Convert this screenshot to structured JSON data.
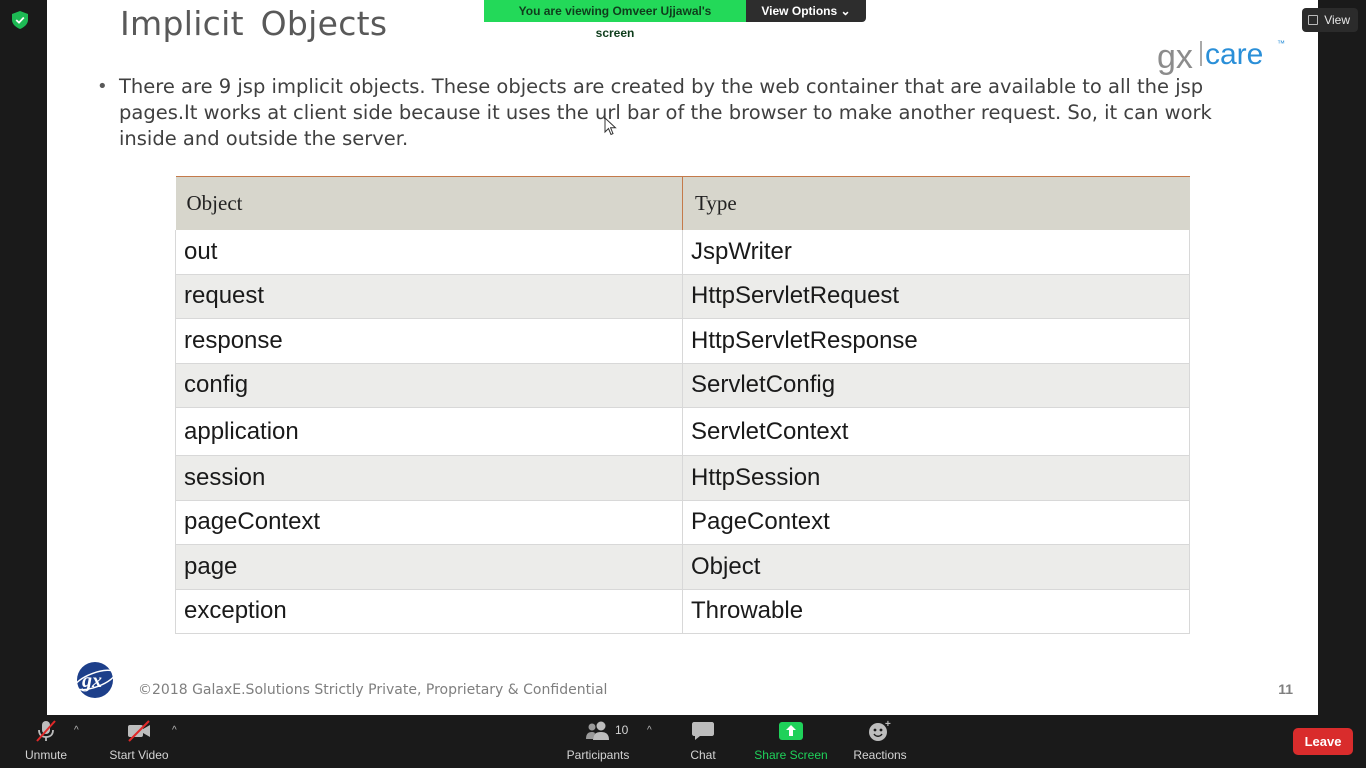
{
  "banner": {
    "message": "You are viewing Omveer Ujjawal's screen",
    "view_options": "View Options",
    "view_options_icon": "chevron-down-icon"
  },
  "view_button": {
    "label": "View",
    "icon": "grid-view-icon"
  },
  "slide": {
    "title": "Implicit  Objects",
    "logo_text": "gx|care™",
    "bullet": "There are 9 jsp implicit objects. These objects are created by the web container that are available to all the jsp pages.It works at client side because it uses the url bar of the browser to make another request. So, it can work inside and outside the server.",
    "table": {
      "headers": [
        "Object",
        "Type"
      ],
      "rows": [
        [
          "out",
          "JspWriter"
        ],
        [
          "request",
          "HttpServletRequest"
        ],
        [
          "response",
          "HttpServletResponse"
        ],
        [
          "config",
          "ServletConfig"
        ],
        [
          "application",
          "ServletContext"
        ],
        [
          "session",
          "HttpSession"
        ],
        [
          "pageContext",
          "PageContext"
        ],
        [
          "page",
          "Object"
        ],
        [
          "exception",
          "Throwable"
        ]
      ]
    },
    "footer_text": "©2018 GalaxE.Solutions Strictly Private, Proprietary & Confidential",
    "page_number": "11"
  },
  "toolbar": {
    "unmute": "Unmute",
    "start_video": "Start Video",
    "participants": "Participants",
    "participants_count": "10",
    "chat": "Chat",
    "share_screen": "Share Screen",
    "reactions": "Reactions",
    "leave": "Leave"
  },
  "colors": {
    "banner_green": "#23d959",
    "share_green": "#1fd15a",
    "leave_red": "#d92c2c",
    "table_header": "#d7d6cc"
  }
}
